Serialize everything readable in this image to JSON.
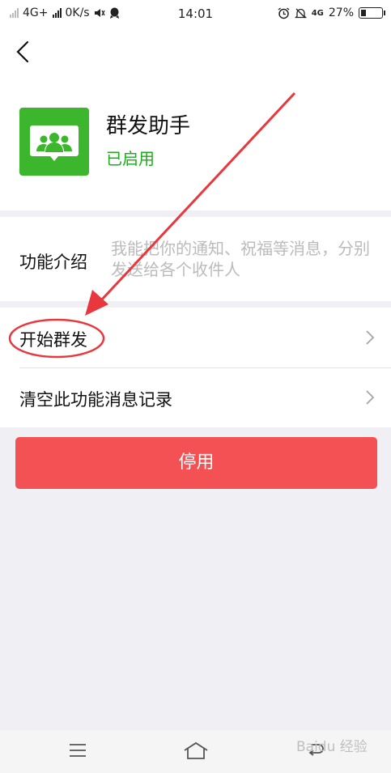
{
  "status_bar": {
    "network": "4G+",
    "speed": "0K/s",
    "time": "14:01",
    "network_right": "4G",
    "battery": "27%",
    "battery_level": 0.27
  },
  "header": {
    "app_name": "群发助手",
    "app_status": "已启用",
    "icon_color": "#3cb62c",
    "status_color": "#1aad19"
  },
  "intro": {
    "label": "功能介绍",
    "text": "我能把你的通知、祝福等消息，分别发送给各个收件人"
  },
  "menu": [
    {
      "label": "开始群发",
      "icon": "chevron-right-icon"
    },
    {
      "label": "清空此功能消息记录",
      "icon": "chevron-right-icon"
    }
  ],
  "disable_button": {
    "label": "停用",
    "color": "#f35153"
  },
  "nav_bar": {
    "buttons": [
      "menu-icon",
      "home-icon",
      "back-icon"
    ]
  },
  "watermark": {
    "text": "Baidu 经验"
  },
  "annotation": {
    "color": "#e8383d"
  }
}
